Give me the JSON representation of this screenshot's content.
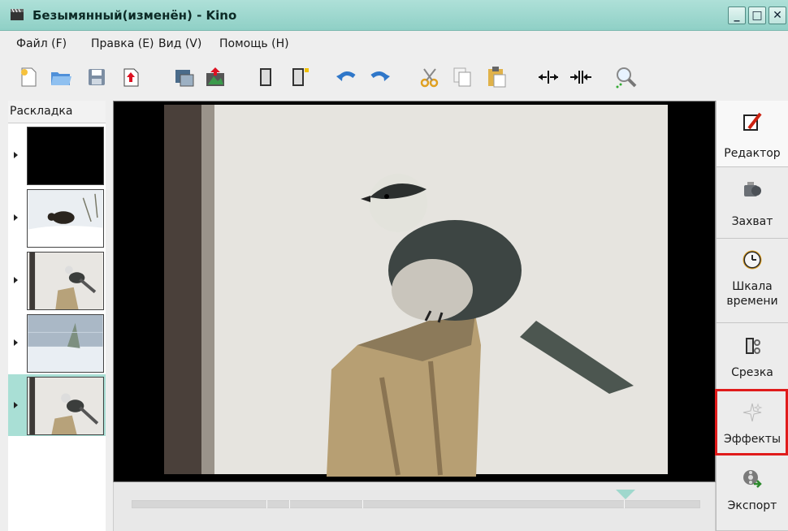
{
  "window": {
    "title": "Безымянный(изменён) - Kino",
    "app_icon": "kino-clapper-icon",
    "controls": {
      "minimize": "_",
      "maximize": "□",
      "close": "✕"
    }
  },
  "menubar": {
    "items": [
      {
        "label": "Файл (F)"
      },
      {
        "label": "Правка (E)"
      },
      {
        "label": "Вид (V)"
      },
      {
        "label": "Помощь (H)"
      }
    ]
  },
  "toolbar": {
    "buttons": [
      "new-file-icon",
      "open-folder-icon",
      "save-icon",
      "save-as-icon",
      "save-frame-icon",
      "export-image-icon",
      "insert-before-icon",
      "insert-after-icon",
      "undo-icon",
      "redo-icon",
      "cut-icon",
      "copy-icon",
      "paste-icon",
      "split-scene-icon",
      "join-scenes-icon",
      "zoom-icon"
    ]
  },
  "storyboard": {
    "header": "Раскладка",
    "scenes": [
      {
        "name": "scene-1",
        "selected": false
      },
      {
        "name": "scene-2",
        "selected": false
      },
      {
        "name": "scene-3",
        "selected": false
      },
      {
        "name": "scene-4",
        "selected": false
      },
      {
        "name": "scene-5",
        "selected": true
      }
    ]
  },
  "player": {
    "scrubber_position": 0.88
  },
  "right_nav": {
    "tabs": [
      {
        "label": "Редактор",
        "icon": "editor-icon"
      },
      {
        "label": "Захват",
        "icon": "camcorder-icon"
      },
      {
        "label": "Шкала времени",
        "line1": "Шкала",
        "line2": "времени",
        "icon": "clock-icon"
      },
      {
        "label": "Срезка",
        "icon": "trim-icon"
      },
      {
        "label": "Эффекты",
        "icon": "sparkle-effects-icon"
      },
      {
        "label": "Экспорт",
        "icon": "film-export-icon"
      }
    ],
    "highlighted": "Эффекты"
  },
  "colors": {
    "titlebar": "#9fd8cd",
    "selected_row": "#a9dfd5",
    "highlight_box": "#e01b1b"
  }
}
